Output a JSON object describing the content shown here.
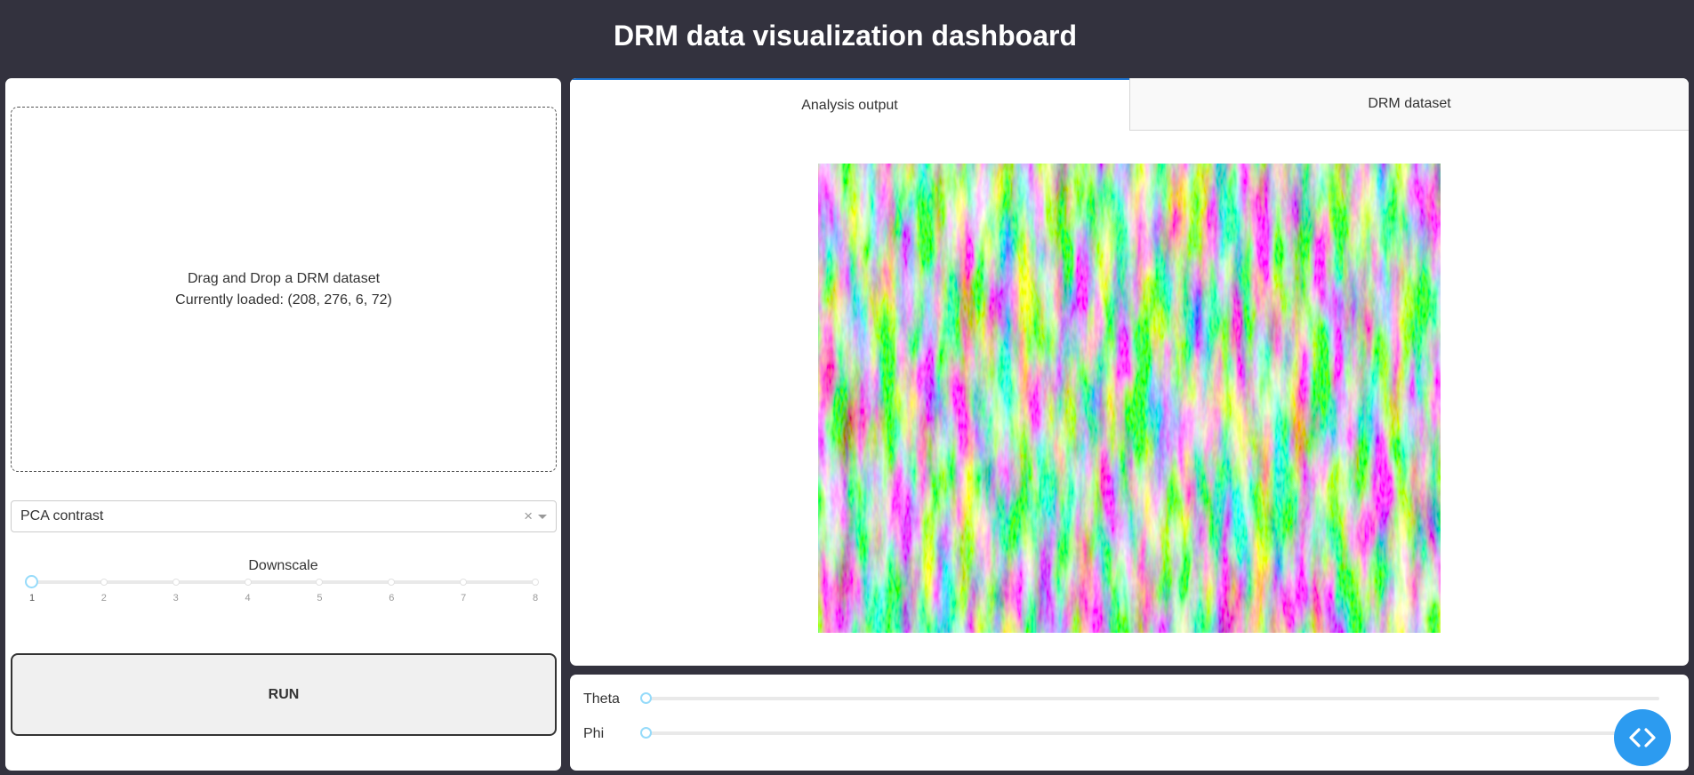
{
  "header": {
    "title": "DRM data visualization dashboard"
  },
  "upload": {
    "line1": "Drag and Drop a DRM dataset",
    "line2": "Currently loaded: (208, 276, 6, 72)"
  },
  "method_select": {
    "value": "PCA contrast",
    "clear_glyph": "×"
  },
  "downscale": {
    "label": "Downscale",
    "marks": [
      "1",
      "2",
      "3",
      "4",
      "5",
      "6",
      "7",
      "8"
    ],
    "value": 1
  },
  "run_button": {
    "label": "RUN"
  },
  "tabs": [
    {
      "label": "Analysis output",
      "active": true
    },
    {
      "label": "DRM dataset",
      "active": false
    }
  ],
  "sliders": {
    "theta": {
      "label": "Theta",
      "value_fraction": 0
    },
    "phi": {
      "label": "Phi",
      "value_fraction": 0
    }
  },
  "colors": {
    "background": "#33323e",
    "tab_accent": "#1f77d4",
    "slider_handle": "#96dbfa",
    "fab": "#2c9bf0"
  },
  "icons": {
    "fab": "code-brackets-icon"
  }
}
